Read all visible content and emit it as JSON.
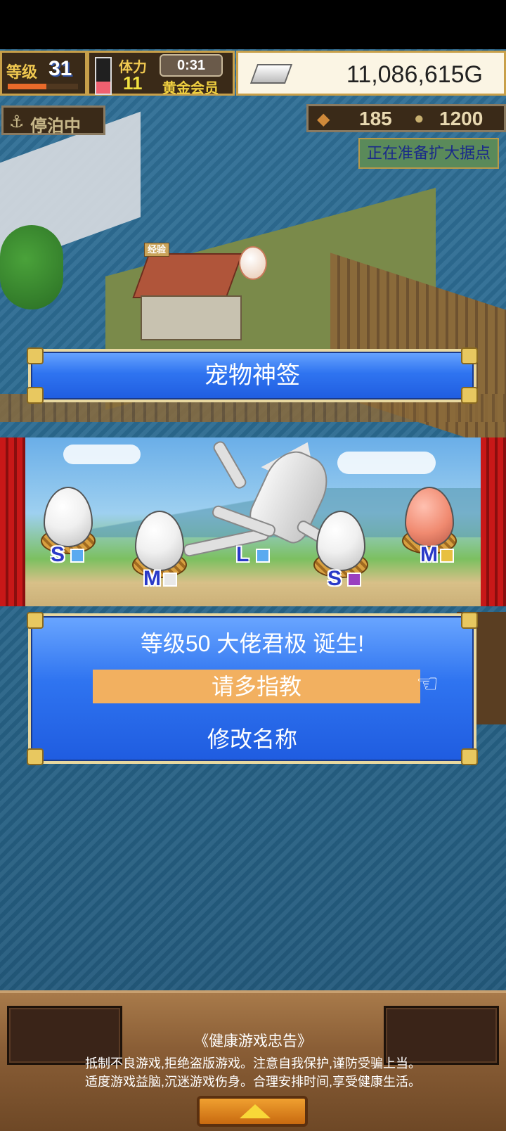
{
  "hud": {
    "level_label": "等级",
    "level_value": "31",
    "level_exp_fraction": 0.55,
    "stamina_label": "体力",
    "stamina_value": "11",
    "stamina_gauge_fraction": 0.35,
    "timer": "0:31",
    "membership": "黄金会员",
    "money": "11,086,615G"
  },
  "status": {
    "moored": "停泊中",
    "resource_1_value": "185",
    "resource_2_value": "1200",
    "expand_notice": "正在准备扩大据点"
  },
  "map": {
    "exp_tag": "经验"
  },
  "dialog": {
    "title": "宠物神签"
  },
  "scene": {
    "eggs": [
      {
        "size": "S",
        "type_color": "#5aaaf0",
        "egg_color": "white"
      },
      {
        "size": "M",
        "type_color": "#e8e8e8",
        "egg_color": "white"
      },
      {
        "size": "L",
        "type_color": "#5aaaf0",
        "egg_color": "white"
      },
      {
        "size": "S",
        "type_color": "#9a40c0",
        "egg_color": "white"
      },
      {
        "size": "M",
        "type_color": "#e8c040",
        "egg_color": "pink"
      }
    ]
  },
  "result": {
    "message": "等级50 大佬君极 诞生!",
    "option_greet": "请多指教",
    "option_rename": "修改名称"
  },
  "footer": {
    "advisory_title": "《健康游戏忠告》",
    "advisory_line1": "抵制不良游戏,拒绝盗版游戏。注意自我保护,谨防受骗上当。",
    "advisory_line2": "适度游戏益脑,沉迷游戏伤身。合理安排时间,享受健康生活。"
  },
  "colors": {
    "dialog_blue": "#2f74f0",
    "highlight_orange": "#f2b060",
    "gold_border": "#c8a04a"
  }
}
